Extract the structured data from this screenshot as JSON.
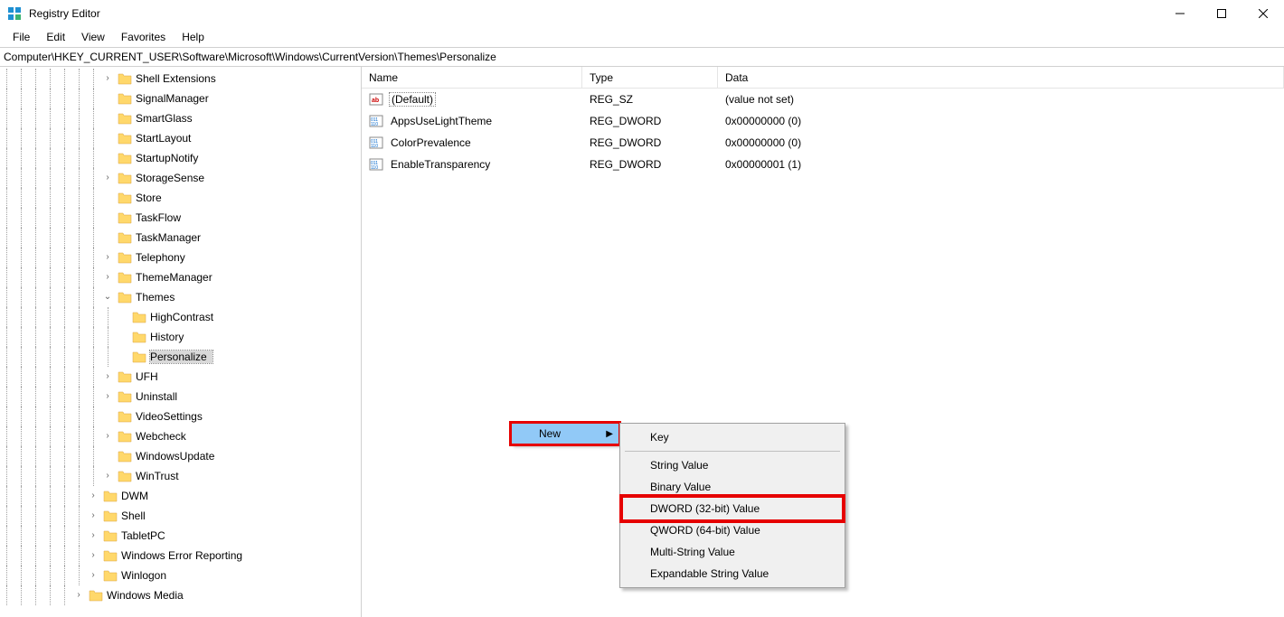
{
  "app": {
    "title": "Registry Editor"
  },
  "menu": {
    "items": [
      "File",
      "Edit",
      "View",
      "Favorites",
      "Help"
    ]
  },
  "address": "Computer\\HKEY_CURRENT_USER\\Software\\Microsoft\\Windows\\CurrentVersion\\Themes\\Personalize",
  "tree": {
    "items": [
      {
        "depth": 7,
        "exp": ">",
        "label": "Shell Extensions"
      },
      {
        "depth": 7,
        "exp": "",
        "label": "SignalManager"
      },
      {
        "depth": 7,
        "exp": "",
        "label": "SmartGlass"
      },
      {
        "depth": 7,
        "exp": "",
        "label": "StartLayout"
      },
      {
        "depth": 7,
        "exp": "",
        "label": "StartupNotify"
      },
      {
        "depth": 7,
        "exp": ">",
        "label": "StorageSense"
      },
      {
        "depth": 7,
        "exp": "",
        "label": "Store"
      },
      {
        "depth": 7,
        "exp": "",
        "label": "TaskFlow"
      },
      {
        "depth": 7,
        "exp": "",
        "label": "TaskManager"
      },
      {
        "depth": 7,
        "exp": ">",
        "label": "Telephony"
      },
      {
        "depth": 7,
        "exp": ">",
        "label": "ThemeManager"
      },
      {
        "depth": 7,
        "exp": "v",
        "label": "Themes"
      },
      {
        "depth": 8,
        "exp": "",
        "label": "HighContrast"
      },
      {
        "depth": 8,
        "exp": "",
        "label": "History"
      },
      {
        "depth": 8,
        "exp": "",
        "label": "Personalize",
        "selected": true
      },
      {
        "depth": 7,
        "exp": ">",
        "label": "UFH"
      },
      {
        "depth": 7,
        "exp": ">",
        "label": "Uninstall"
      },
      {
        "depth": 7,
        "exp": "",
        "label": "VideoSettings"
      },
      {
        "depth": 7,
        "exp": ">",
        "label": "Webcheck"
      },
      {
        "depth": 7,
        "exp": "",
        "label": "WindowsUpdate"
      },
      {
        "depth": 7,
        "exp": ">",
        "label": "WinTrust"
      },
      {
        "depth": 6,
        "exp": ">",
        "label": "DWM"
      },
      {
        "depth": 6,
        "exp": ">",
        "label": "Shell"
      },
      {
        "depth": 6,
        "exp": ">",
        "label": "TabletPC"
      },
      {
        "depth": 6,
        "exp": ">",
        "label": "Windows Error Reporting"
      },
      {
        "depth": 6,
        "exp": ">",
        "label": "Winlogon"
      },
      {
        "depth": 5,
        "exp": ">",
        "label": "Windows Media"
      }
    ]
  },
  "list": {
    "headers": {
      "name": "Name",
      "type": "Type",
      "data": "Data"
    },
    "rows": [
      {
        "icon": "sz",
        "name": "(Default)",
        "type": "REG_SZ",
        "data": "(value not set)",
        "focused": true
      },
      {
        "icon": "bin",
        "name": "AppsUseLightTheme",
        "type": "REG_DWORD",
        "data": "0x00000000 (0)"
      },
      {
        "icon": "bin",
        "name": "ColorPrevalence",
        "type": "REG_DWORD",
        "data": "0x00000000 (0)"
      },
      {
        "icon": "bin",
        "name": "EnableTransparency",
        "type": "REG_DWORD",
        "data": "0x00000001 (1)"
      }
    ]
  },
  "ctx": {
    "primary": "New",
    "sub": [
      "Key",
      "String Value",
      "Binary Value",
      "DWORD (32-bit) Value",
      "QWORD (64-bit) Value",
      "Multi-String Value",
      "Expandable String Value"
    ],
    "highlight_primary": 0,
    "highlight_sub_red": 3
  }
}
